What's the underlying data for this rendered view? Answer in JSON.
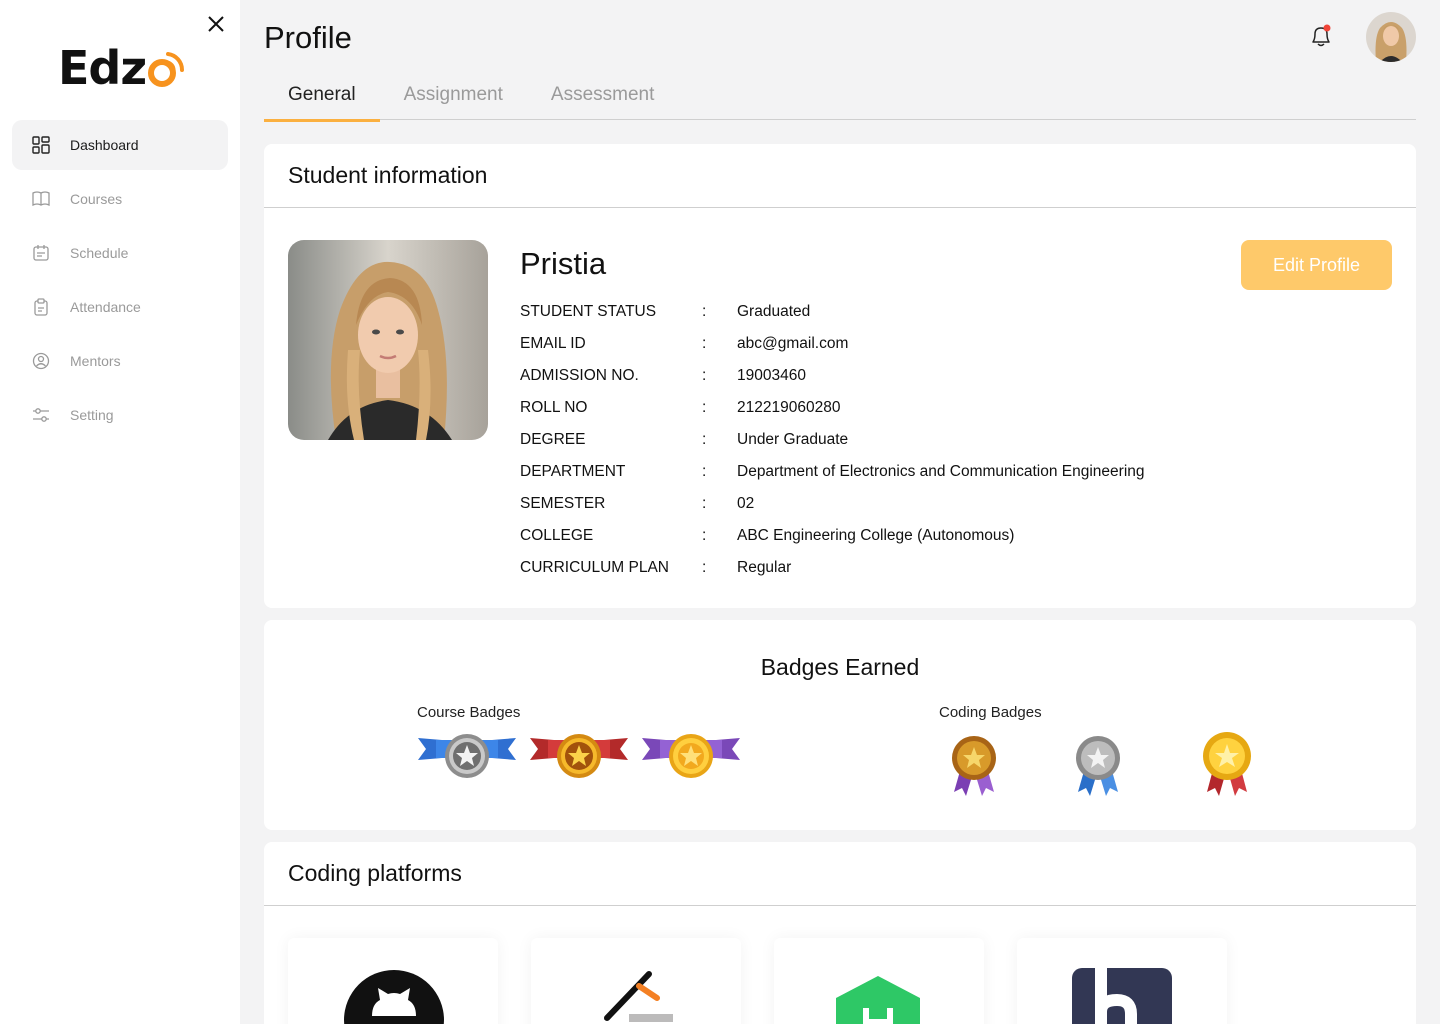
{
  "app": {
    "logo_text": "Edz",
    "page_title": "Profile"
  },
  "sidebar": {
    "items": [
      {
        "label": "Dashboard",
        "icon": "grid-icon"
      },
      {
        "label": "Courses",
        "icon": "book-icon"
      },
      {
        "label": "Schedule",
        "icon": "calendar-icon"
      },
      {
        "label": "Attendance",
        "icon": "clipboard-icon"
      },
      {
        "label": "Mentors",
        "icon": "user-circle-icon"
      },
      {
        "label": "Setting",
        "icon": "sliders-icon"
      }
    ]
  },
  "tabs": [
    {
      "label": "General"
    },
    {
      "label": "Assignment"
    },
    {
      "label": "Assessment"
    }
  ],
  "student": {
    "section_title": "Student information",
    "name": "Pristia",
    "edit_label": "Edit Profile",
    "fields": [
      {
        "label": "STUDENT STATUS",
        "value": "Graduated"
      },
      {
        "label": "EMAIL ID",
        "value": "abc@gmail.com"
      },
      {
        "label": "ADMISSION NO.",
        "value": "19003460"
      },
      {
        "label": "ROLL NO",
        "value": "212219060280"
      },
      {
        "label": "DEGREE",
        "value": "Under Graduate"
      },
      {
        "label": "DEPARTMENT",
        "value": "Department of Electronics and Communication Engineering"
      },
      {
        "label": "SEMESTER",
        "value": "02"
      },
      {
        "label": "COLLEGE",
        "value": "ABC Engineering College (Autonomous)"
      },
      {
        "label": "CURRICULUM PLAN",
        "value": "Regular"
      }
    ],
    "separator": ":"
  },
  "badges": {
    "title": "Badges Earned",
    "course_label": "Course Badges",
    "coding_label": "Coding Badges"
  },
  "platforms": {
    "title": "Coding platforms",
    "items": [
      {
        "icon": "github-icon"
      },
      {
        "icon": "stackoverflow-icon"
      },
      {
        "icon": "hackerrank-icon"
      },
      {
        "icon": "hackerearth-icon"
      }
    ]
  },
  "colors": {
    "accent": "#fbb040",
    "button": "#fec96a",
    "background": "#f3f3f4"
  }
}
